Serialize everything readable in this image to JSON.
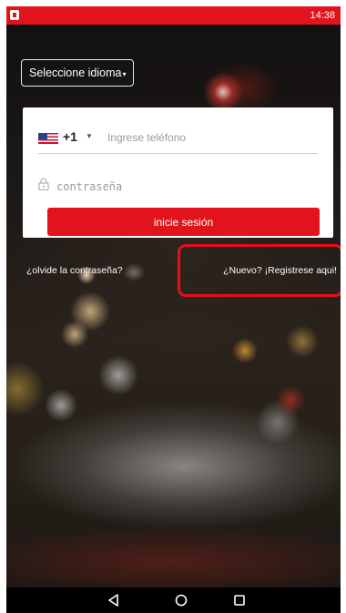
{
  "status_bar": {
    "time": "14:38",
    "app_icon": "app-notification-icon",
    "background_color": "#e1141d"
  },
  "language_selector": {
    "label": "Seleccione idioma",
    "caret_icon": "dropdown-caret-icon"
  },
  "login_form": {
    "country_flag_icon": "us-flag-icon",
    "dial_code": "+1",
    "dial_caret_icon": "chevron-down-icon",
    "phone_placeholder": "Ingrese teléfono",
    "phone_value": "",
    "lock_icon": "lock-icon",
    "password_placeholder": "contraseña",
    "password_value": "",
    "submit_label": "inicie sesión"
  },
  "links": {
    "forgot_password": "¿olvide la contraseña?",
    "register": "¿Nuevo? ¡Registrese aqui!"
  },
  "nav_bar": {
    "back_icon": "back-triangle-icon",
    "home_icon": "home-circle-icon",
    "recents_icon": "recents-square-icon"
  },
  "colors": {
    "accent": "#e1141d",
    "highlight_border": "#e3101b"
  }
}
